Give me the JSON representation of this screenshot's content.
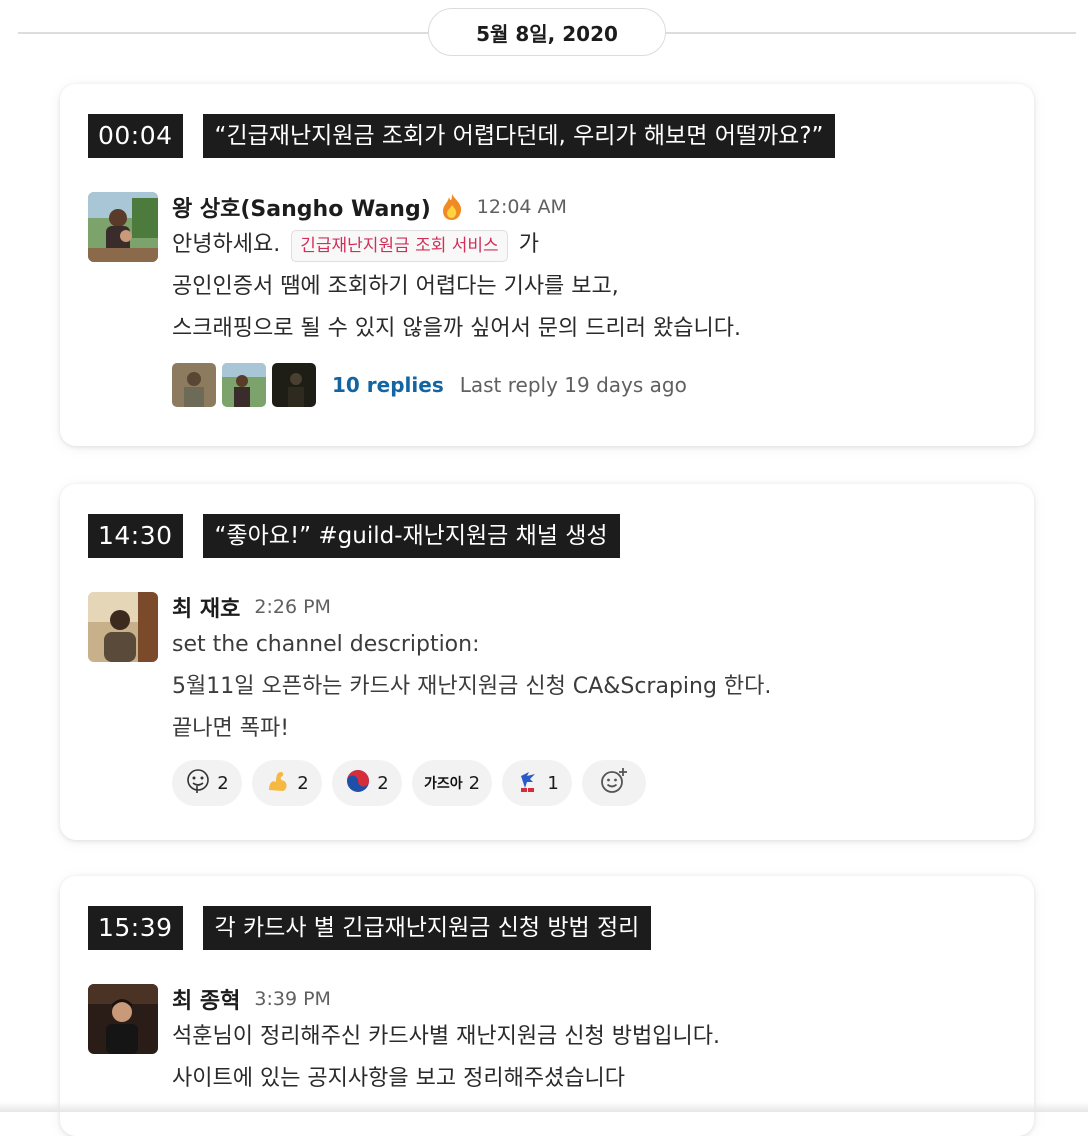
{
  "date_divider": {
    "label": "5월 8일, 2020"
  },
  "cards": [
    {
      "time": "00:04",
      "title": "“긴급재난지원금 조회가 어렵다던데, 우리가 해보면 어떨까요?”",
      "author": "왕 상호(Sangho Wang)",
      "author_badge_icon": "fire-emoji-icon",
      "timestamp": "12:04 AM",
      "lines": {
        "l1_pre": "안녕하세요.",
        "l1_code": "긴급재난지원금 조회 서비스",
        "l1_post": "가",
        "l2": "공인인증서 땜에 조회하기 어렵다는 기사를 보고,",
        "l3": "스크래핑으로 될 수 있지 않을까 싶어서 문의 드리러 왔습니다."
      },
      "thread": {
        "replies": "10 replies",
        "last_reply": "Last reply 19 days ago"
      }
    },
    {
      "time": "14:30",
      "title": "“좋아요!” #guild-재난지원금 채널 생성",
      "author": "최 재호",
      "timestamp": "2:26 PM",
      "lines": {
        "l1": "set the channel description:",
        "l2": "5월11일 오픈하는 카드사 재난지원금 신청 CA&Scraping 한다.",
        "l3": "끝나면 폭파!"
      },
      "reactions": [
        {
          "icon": "drooling-face-emoji-icon",
          "count": "2"
        },
        {
          "icon": "flexed-biceps-emoji-icon",
          "count": "2"
        },
        {
          "icon": "taegeuk-emoji-icon",
          "count": "2"
        },
        {
          "icon": "gajua-text-emoji-icon",
          "label": "가즈아",
          "count": "2"
        },
        {
          "icon": "sonic-emoji-icon",
          "count": "1"
        },
        {
          "icon": "add-reaction-icon"
        }
      ]
    },
    {
      "time": "15:39",
      "title": "각 카드사 별 긴급재난지원금 신청 방법 정리",
      "author": "최 종혁",
      "timestamp": "3:39 PM",
      "lines": {
        "l1": "석훈님이 정리해주신 카드사별 재난지원금 신청 방법입니다.",
        "l2": "사이트에 있는 공지사항을 보고 정리해주셨습니다"
      }
    }
  ],
  "colors": {
    "tag_bg": "#1c1c1c",
    "link": "#1264a3",
    "code_text": "#d12f5a",
    "reaction_bg": "#f2f2f2"
  }
}
